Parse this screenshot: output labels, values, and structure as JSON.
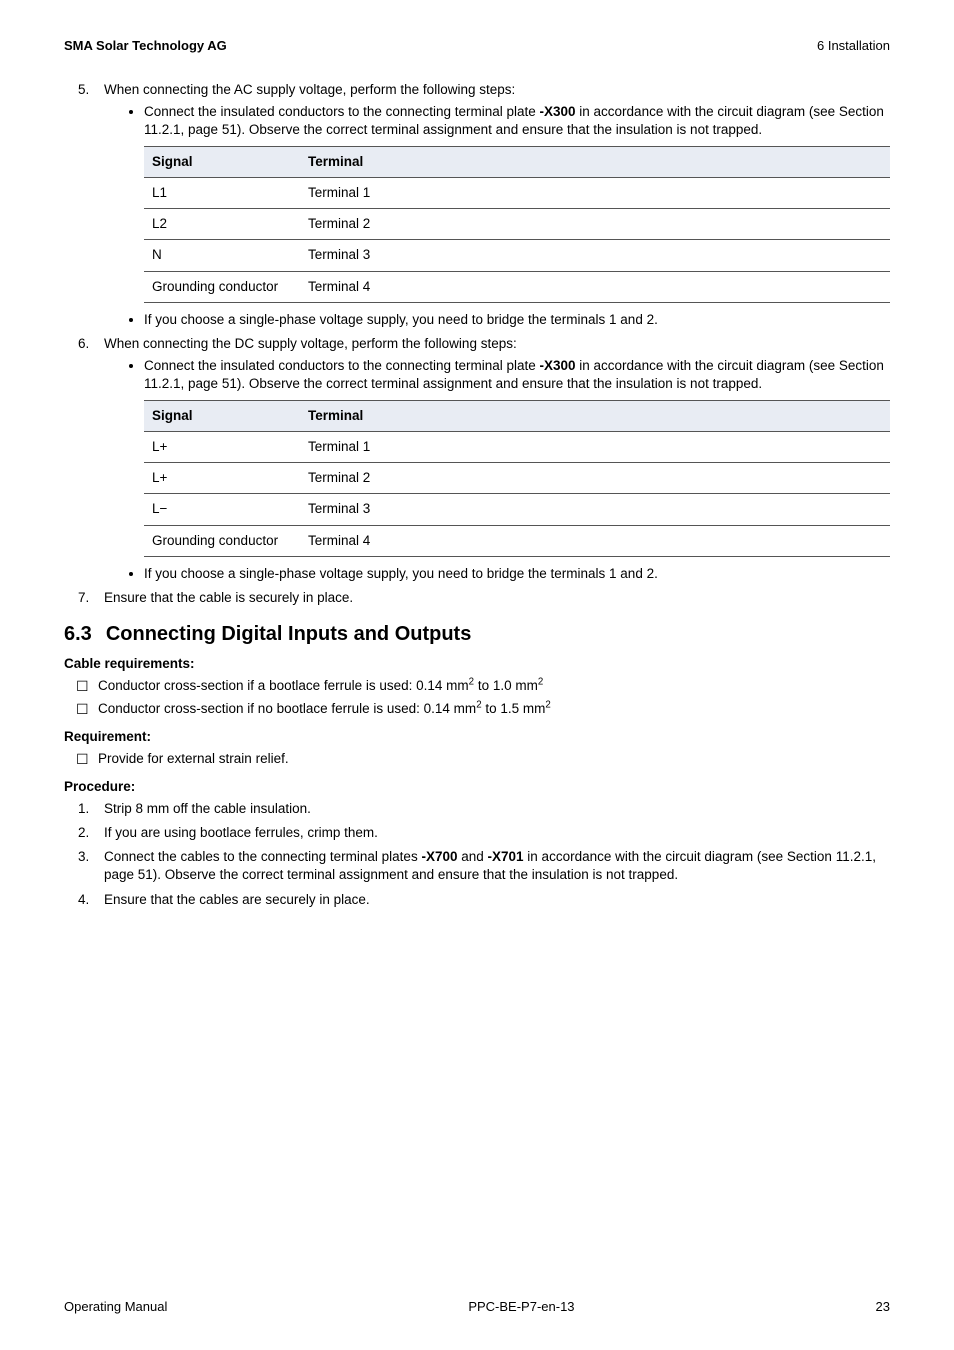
{
  "header": {
    "company": "SMA Solar Technology AG",
    "section_label": "6  Installation"
  },
  "steps": [
    {
      "num": "5.",
      "text": "When connecting the AC supply voltage, perform the following steps:",
      "bullets_pre": [
        "Connect the insulated conductors to the connecting terminal plate -X300 in accordance with the circuit diagram (see Section 11.2.1, page 51). Observe the correct terminal assignment and ensure that the insulation is not trapped."
      ],
      "table": {
        "headers": [
          "Signal",
          "Terminal"
        ],
        "rows": [
          [
            "L1",
            "Terminal 1"
          ],
          [
            "L2",
            "Terminal 2"
          ],
          [
            "N",
            "Terminal 3"
          ],
          [
            "Grounding conductor",
            "Terminal 4"
          ]
        ]
      },
      "bullets_post": [
        "If you choose a single-phase voltage supply, you need to bridge the terminals 1 and 2."
      ]
    },
    {
      "num": "6.",
      "text": "When connecting the DC supply voltage, perform the following steps:",
      "bullets_pre": [
        "Connect the insulated conductors to the connecting terminal plate -X300 in accordance with the circuit diagram (see Section 11.2.1, page 51). Observe the correct terminal assignment and ensure that the insulation is not trapped."
      ],
      "table": {
        "headers": [
          "Signal",
          "Terminal"
        ],
        "rows": [
          [
            "L+",
            "Terminal 1"
          ],
          [
            "L+",
            "Terminal 2"
          ],
          [
            "L−",
            "Terminal 3"
          ],
          [
            "Grounding conductor",
            "Terminal 4"
          ]
        ]
      },
      "bullets_post": [
        "If you choose a single-phase voltage supply, you need to bridge the terminals 1 and 2."
      ]
    },
    {
      "num": "7.",
      "text": "Ensure that the cable is securely in place."
    }
  ],
  "section63": {
    "number": "6.3",
    "title": "Connecting Digital Inputs and Outputs",
    "cable_req_head": "Cable requirements:",
    "cable_reqs_html": [
      "Conductor cross-section if a bootlace ferrule is used: 0.14 mm<sup>2</sup> to 1.0 mm<sup>2</sup>",
      "Conductor cross-section if no bootlace ferrule is used: 0.14 mm<sup>2</sup> to 1.5 mm<sup>2</sup>"
    ],
    "req_head": "Requirement:",
    "reqs": [
      "Provide for external strain relief."
    ],
    "proc_head": "Procedure:",
    "procedure_html": [
      "Strip 8 mm off the cable insulation.",
      "If you are using bootlace ferrules, crimp them.",
      "Connect the cables to the connecting terminal plates <b>-X700</b> and <b>-X701</b> in accordance with the circuit diagram (see Section 11.2.1, page 51). Observe the correct terminal assignment and ensure that the insulation is not trapped.",
      "Ensure that the cables are securely in place."
    ]
  },
  "footer": {
    "left": "Operating Manual",
    "center": "PPC-BE-P7-en-13",
    "right": "23"
  }
}
